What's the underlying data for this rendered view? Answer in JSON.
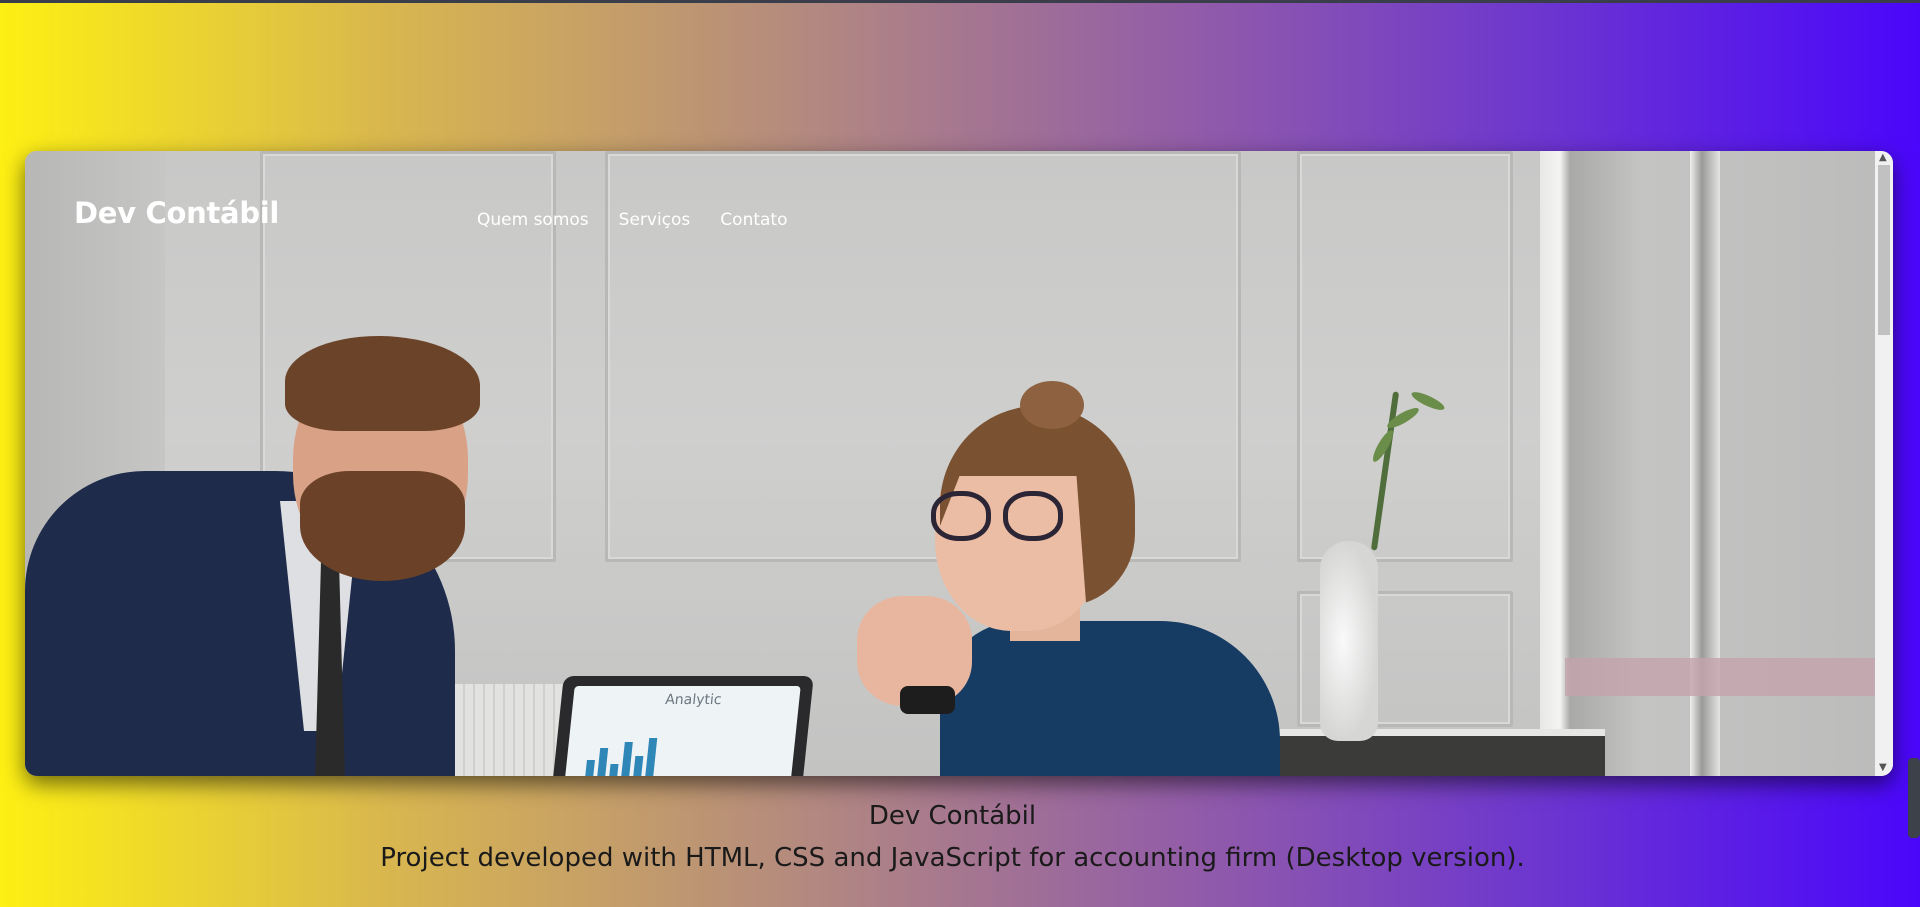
{
  "site": {
    "brand": "Dev Contábil",
    "nav": [
      "Quem somos",
      "Serviços",
      "Contato"
    ]
  },
  "hero": {
    "laptop_screen_text": "Analytic"
  },
  "caption": {
    "title": "Dev Contábil",
    "description": "Project developed with HTML, CSS and JavaScript for accounting firm (Desktop version)."
  },
  "colors": {
    "gradient_start": "#fdf013",
    "gradient_end": "#4a06fb"
  }
}
